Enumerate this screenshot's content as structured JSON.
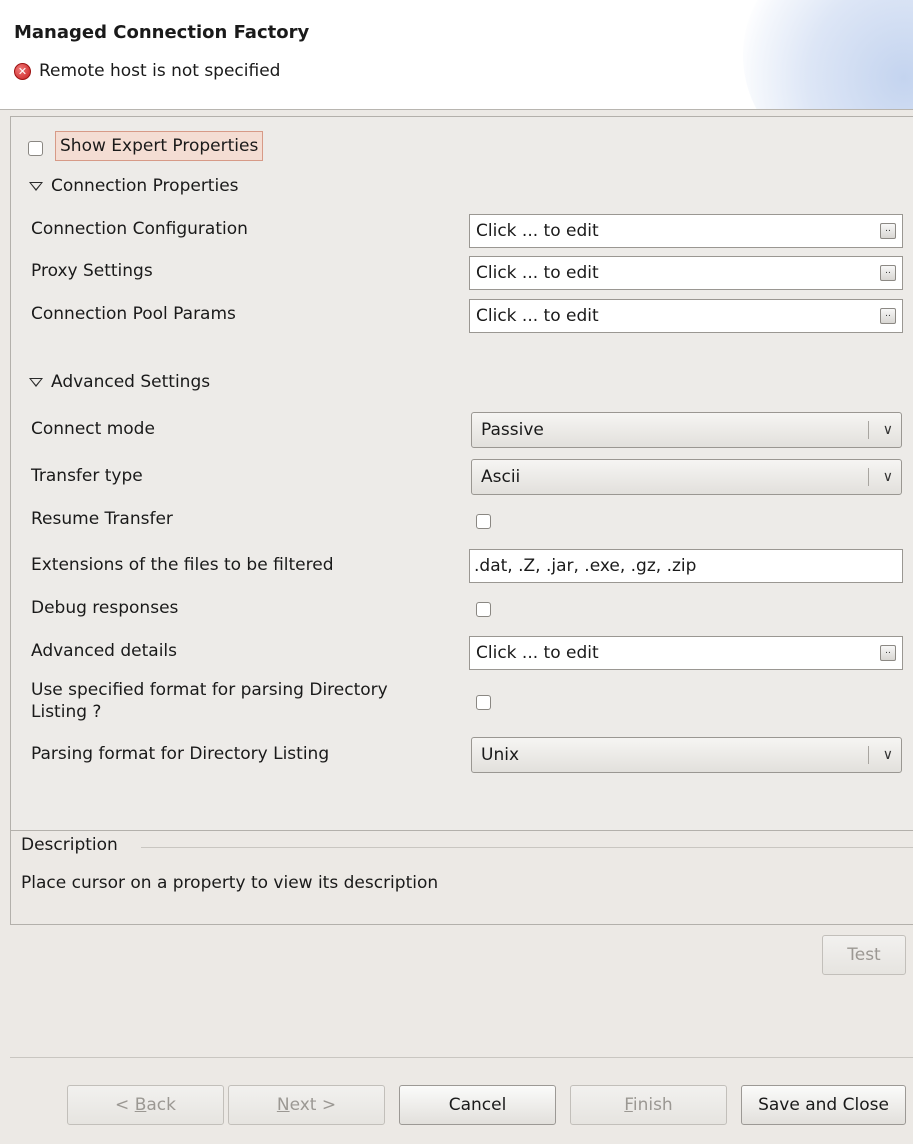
{
  "header": {
    "title": "Managed Connection Factory",
    "error_message": "Remote host is not specified",
    "error_icon": "error-circle-icon"
  },
  "properties": {
    "show_expert_label": "Show Expert Properties",
    "show_expert_checked": false,
    "connection_section": {
      "title": "Connection Properties",
      "rows": [
        {
          "label": "Connection Configuration",
          "value": "Click ... to edit"
        },
        {
          "label": "Proxy Settings",
          "value": "Click ... to edit"
        },
        {
          "label": "Connection Pool Params",
          "value": "Click ... to edit"
        }
      ]
    },
    "advanced_section": {
      "title": "Advanced Settings",
      "connect_mode": {
        "label": "Connect mode",
        "value": "Passive"
      },
      "transfer_type": {
        "label": "Transfer type",
        "value": "Ascii"
      },
      "resume_transfer": {
        "label": "Resume Transfer",
        "checked": false
      },
      "extensions": {
        "label": "Extensions of the files to be filtered",
        "value": ".dat, .Z, .jar, .exe, .gz, .zip"
      },
      "debug_responses": {
        "label": "Debug responses",
        "checked": false
      },
      "advanced_details": {
        "label": "Advanced details",
        "value": "Click ... to edit"
      },
      "use_format": {
        "label_line1": "Use specified format for parsing Directory",
        "label_line2": "Listing ?",
        "checked": false
      },
      "parsing_format": {
        "label": "Parsing format for Directory Listing",
        "value": "Unix"
      }
    }
  },
  "description": {
    "title": "Description",
    "text": "Place cursor on a property to view its description"
  },
  "buttons": {
    "test": "Test",
    "back_prefix": "< ",
    "back_mnemonic": "B",
    "back_rest": "ack",
    "next_mnemonic": "N",
    "next_rest": "ext >",
    "cancel": "Cancel",
    "finish_mnemonic": "F",
    "finish_rest": "inish",
    "save_close": "Save and Close"
  },
  "colors": {
    "error": "#c81c1c",
    "expert_highlight": "#f4ddd3"
  }
}
